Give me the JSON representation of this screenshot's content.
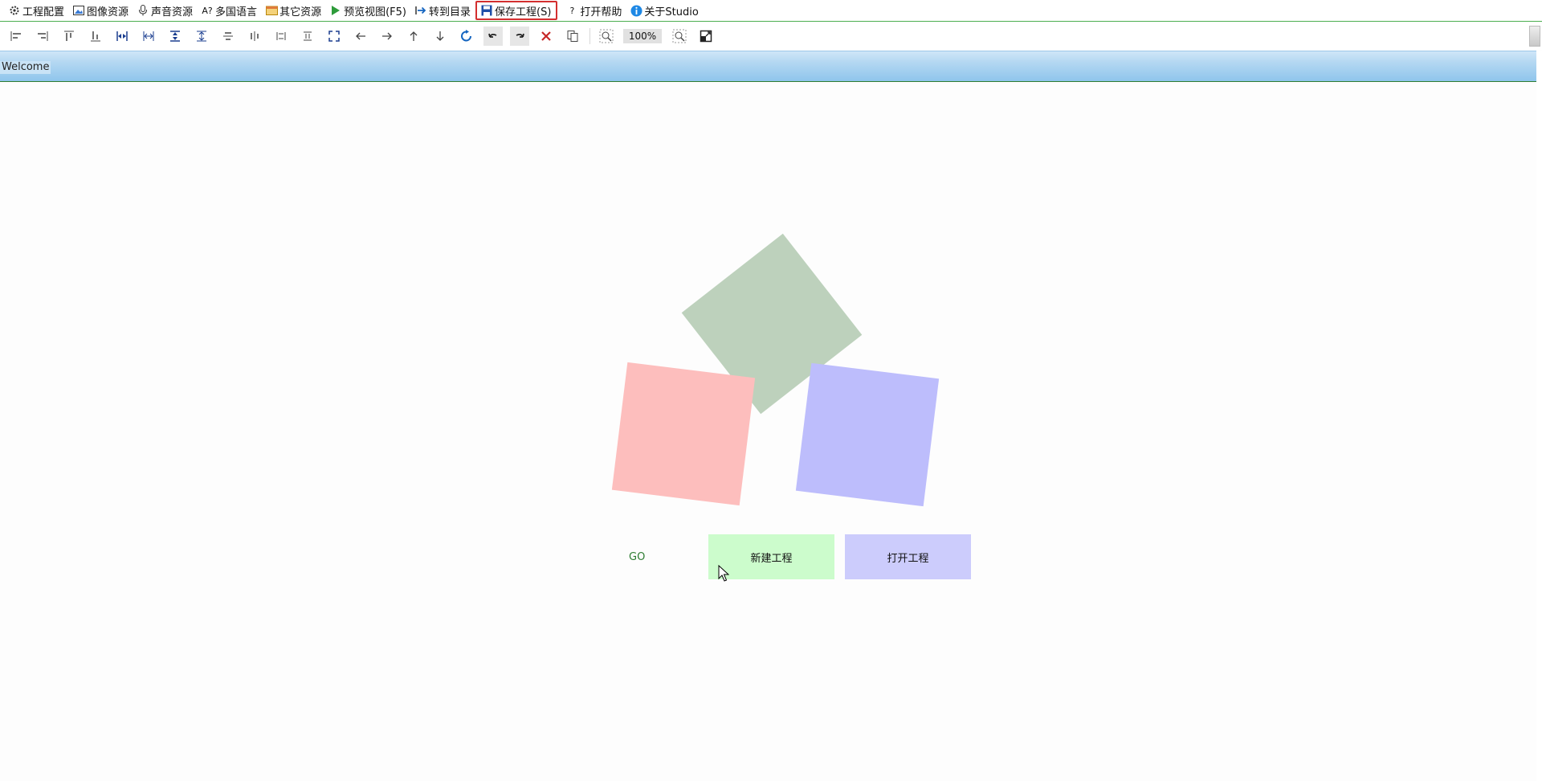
{
  "menubar": {
    "items": [
      {
        "label": "工程配置",
        "icon": "gear-icon"
      },
      {
        "label": "图像资源",
        "icon": "image-icon"
      },
      {
        "label": "声音资源",
        "icon": "microphone-icon"
      },
      {
        "label": "多国语言",
        "icon": "translate-icon"
      },
      {
        "label": "其它资源",
        "icon": "folder-icon"
      },
      {
        "label": "预览视图(F5)",
        "icon": "play-icon"
      },
      {
        "label": "转到目录",
        "icon": "goto-arrow-icon"
      },
      {
        "label": "保存工程(S)",
        "icon": "save-icon"
      },
      {
        "label": "打开帮助",
        "icon": "help-icon"
      },
      {
        "label": "关于Studio",
        "icon": "info-icon"
      }
    ]
  },
  "toolbar": {
    "zoom": "100%",
    "buttons": [
      "align-left-icon",
      "align-right-icon",
      "align-top-icon",
      "align-bottom-icon",
      "same-width-icon",
      "distribute-horizontal-icon",
      "same-height-icon",
      "distribute-vertical-icon",
      "center-vertical-icon",
      "center-horizontal-icon",
      "space-horizontal-icon",
      "space-vertical-icon",
      "fit-size-icon",
      "move-left-icon",
      "move-right-icon",
      "move-up-icon",
      "move-down-icon",
      "refresh-icon",
      "undo-icon",
      "redo-icon",
      "delete-icon",
      "copy-icon",
      "zoom-in-icon",
      "zoom-out-icon",
      "fit-window-icon"
    ]
  },
  "tab": {
    "label": "Welcome"
  },
  "canvas": {
    "go_label": "GO",
    "new_project_label": "新建工程",
    "open_project_label": "打开工程"
  },
  "colors": {
    "menu_border": "#4caf50",
    "active_outline": "#d32f2f",
    "card_green": "#bdd1bc",
    "card_red": "#fdbebd",
    "card_blue": "#bdbdfc",
    "button_green": "#ccfccc",
    "button_blue": "#ccccfc"
  }
}
